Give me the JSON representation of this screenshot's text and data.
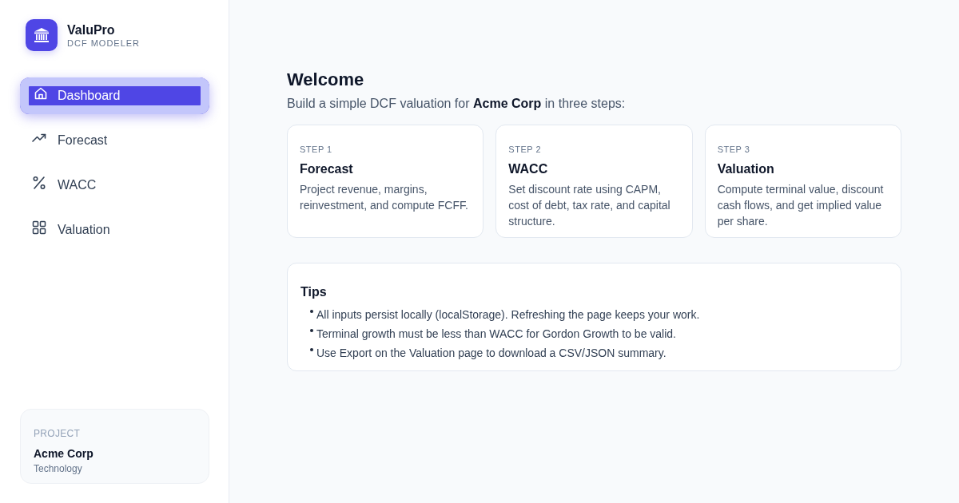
{
  "brand": {
    "name": "ValuPro",
    "subtitle": "DCF MODELER"
  },
  "nav": [
    {
      "label": "Dashboard",
      "selected": true
    },
    {
      "label": "Forecast",
      "selected": false
    },
    {
      "label": "WACC",
      "selected": false
    },
    {
      "label": "Valuation",
      "selected": false
    }
  ],
  "project": {
    "heading": "PROJECT",
    "name": "Acme Corp",
    "industry": "Technology"
  },
  "welcome": {
    "title": "Welcome",
    "subtitle": "Build a simple DCF valuation for **Acme Corp** in three steps:"
  },
  "steps": [
    {
      "step": "STEP 1",
      "title": "Forecast",
      "description": "Project revenue, margins, reinvestment, and compute FCFF."
    },
    {
      "step": "STEP 2",
      "title": "WACC",
      "description": "Set discount rate using CAPM, cost of debt, tax rate, and capital structure."
    },
    {
      "step": "STEP 3",
      "title": "Valuation",
      "description": "Compute terminal value, discount cash flows, and get implied value per share."
    }
  ],
  "tips": {
    "title": "Tips",
    "items": [
      "All inputs persist locally (localStorage). Refreshing the page keeps your work.",
      "Terminal growth must be less than WACC for Gordon Growth to be valid.",
      "Use Export on the Valuation page to download a CSV/JSON summary."
    ]
  }
}
